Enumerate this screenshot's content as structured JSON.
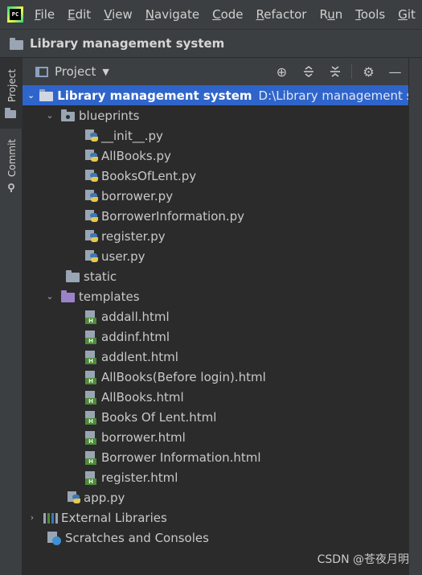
{
  "menu": {
    "logo_text": "PC",
    "items": [
      {
        "label": "File",
        "mnemonic": "F"
      },
      {
        "label": "Edit",
        "mnemonic": "E"
      },
      {
        "label": "View",
        "mnemonic": "V"
      },
      {
        "label": "Navigate",
        "mnemonic": "N"
      },
      {
        "label": "Code",
        "mnemonic": "C"
      },
      {
        "label": "Refactor",
        "mnemonic": "R"
      },
      {
        "label": "Run",
        "mnemonic": "u"
      },
      {
        "label": "Tools",
        "mnemonic": "T"
      },
      {
        "label": "Git",
        "mnemonic": "G"
      }
    ]
  },
  "navbar": {
    "title": "Library management system"
  },
  "sidebar": {
    "tabs": [
      {
        "label": "Project"
      },
      {
        "label": "Commit"
      }
    ]
  },
  "panel": {
    "title": "Project",
    "toolbar_icons": [
      "locate-icon",
      "expand-all-icon",
      "collapse-all-icon",
      "gear-icon",
      "minimize-icon"
    ]
  },
  "tree": {
    "root": {
      "label": "Library management system",
      "path": "D:\\Library management syst"
    },
    "blueprints": {
      "label": "blueprints",
      "files": [
        "__init__.py",
        "AllBooks.py",
        "BooksOfLent.py",
        "borrower.py",
        "BorrowerInformation.py",
        "register.py",
        "user.py"
      ]
    },
    "static": {
      "label": "static"
    },
    "templates": {
      "label": "templates",
      "files": [
        "addall.html",
        "addinf.html",
        "addlent.html",
        "AllBooks(Before login).html",
        "AllBooks.html",
        "Books Of Lent.html",
        "borrower.html",
        "Borrower Information.html",
        "register.html"
      ]
    },
    "app": {
      "label": "app.py"
    },
    "external": {
      "label": "External Libraries"
    },
    "scratches": {
      "label": "Scratches and Consoles"
    }
  },
  "watermark": "CSDN @苍夜月明",
  "colors": {
    "selection": "#2f65ca",
    "background": "#2b2b2b",
    "chrome": "#3c3f41"
  }
}
